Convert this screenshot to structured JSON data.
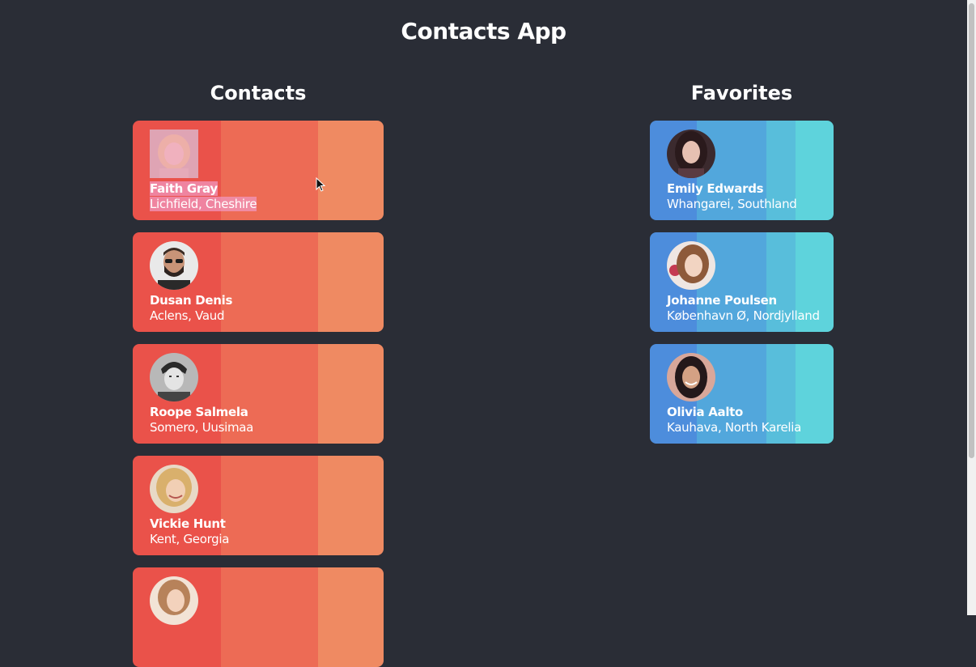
{
  "app": {
    "title": "Contacts App"
  },
  "contacts": {
    "heading": "Contacts",
    "items": [
      {
        "name": "Faith Gray",
        "location": "Lichfield, Cheshire",
        "avatar": "avatar-blonde-woman",
        "selected": true
      },
      {
        "name": "Dusan Denis",
        "location": "Aclens, Vaud",
        "avatar": "avatar-bearded-man-sunglasses"
      },
      {
        "name": "Roope Salmela",
        "location": "Somero, Uusimaa",
        "avatar": "avatar-man-bw"
      },
      {
        "name": "Vickie Hunt",
        "location": "Kent, Georgia",
        "avatar": "avatar-blonde-woman-smiling"
      },
      {
        "name": "",
        "location": "",
        "avatar": "avatar-woman-partial"
      }
    ]
  },
  "favorites": {
    "heading": "Favorites",
    "items": [
      {
        "name": "Emily Edwards",
        "location": "Whangarei, Southland",
        "avatar": "avatar-dark-hair-woman"
      },
      {
        "name": "Johanne Poulsen",
        "location": "København Ø, Nordjylland",
        "avatar": "avatar-brown-hair-woman"
      },
      {
        "name": "Olivia Aalto",
        "location": "Kauhava, North Karelia",
        "avatar": "avatar-dark-hair-woman-smiling"
      }
    ]
  },
  "colors": {
    "background": "#2a2d36",
    "contact_card": [
      "#ea524a",
      "#ed6b55",
      "#ef8a62"
    ],
    "favorite_card": [
      "#4d8ddc",
      "#52a7dc",
      "#58bedb",
      "#5ed3dc"
    ],
    "selection": "#f096be"
  }
}
